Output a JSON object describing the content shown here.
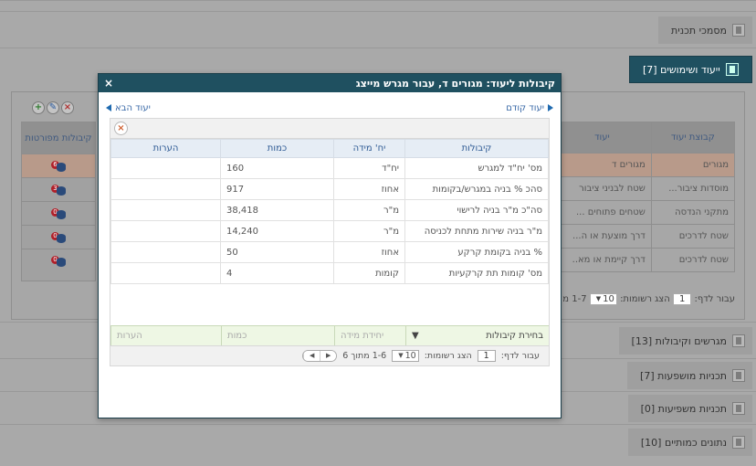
{
  "accordion": {
    "plan_docs": "מסמכי תכנית",
    "uses": "ייעוד ושימושים [7]",
    "lots": "מגרשים וקיבולות [13]",
    "affected_plans": "תכניות מושפעות [7]",
    "affecting_plans": "תכניות משפיעות [0]",
    "quant_data": "נתונים כמותיים [10]"
  },
  "under": {
    "header_group": "קבוצת יעוד",
    "header_use": "יעוד",
    "header_capacities": "קיבולות מפורטות",
    "rows": [
      {
        "group": "מגורים",
        "use": "מגורים ד",
        "badge": "6"
      },
      {
        "group": "מוסדות ציבור...",
        "use": "שטח לבניני ציבור",
        "badge": "3"
      },
      {
        "group": "מתקני הנדסה",
        "use": "שטחים פתוחים ...",
        "badge": "0"
      },
      {
        "group": "שטח לדרכים",
        "use": "דרך מוצעת או ה...",
        "badge": "0"
      },
      {
        "group": "שטח לדרכים",
        "use": "דרך קיימת או מא..",
        "badge": "0"
      }
    ],
    "pager": {
      "goto": "עבור לדף:",
      "page": "1",
      "show": "הצג רשומות:",
      "per": "10",
      "range": "1-7 מ"
    }
  },
  "modal": {
    "title": "קיבולות ליעוד: מגורים ד, עבור מגרש מייצג",
    "close": "×",
    "prev": "יעוד קודם",
    "next": "יעוד הבא",
    "columns": {
      "capacity": "קיבולות",
      "unit": "יח' מידה",
      "amount": "כמות",
      "notes": "הערות"
    },
    "rows": [
      {
        "capacity": "מס' יח\"ד למגרש",
        "unit": "יח\"ד",
        "amount": "160",
        "notes": ""
      },
      {
        "capacity": "סהכ % בניה במגרש/בקומות",
        "unit": "אחוז",
        "amount": "917",
        "notes": ""
      },
      {
        "capacity": "סה\"כ מ\"ר בניה לרישוי",
        "unit": "מ\"ר",
        "amount": "38,418",
        "notes": ""
      },
      {
        "capacity": "מ\"ר בניה שירות מתחת לכניסה",
        "unit": "מ\"ר",
        "amount": "14,240",
        "notes": ""
      },
      {
        "capacity": "% בניה בקומת קרקע",
        "unit": "אחוז",
        "amount": "50",
        "notes": ""
      },
      {
        "capacity": "מס' קומות תת קרקעיות",
        "unit": "קומות",
        "amount": "4",
        "notes": ""
      }
    ],
    "filter": {
      "capacity": "בחירת קיבולות",
      "unit": "יחידת מידה",
      "amount": "כמות",
      "notes": "הערות"
    },
    "pager": {
      "goto": "עבור לדף:",
      "page": "1",
      "show": "הצג רשומות:",
      "per": "10",
      "range": "1-6 מתוך 6"
    }
  }
}
